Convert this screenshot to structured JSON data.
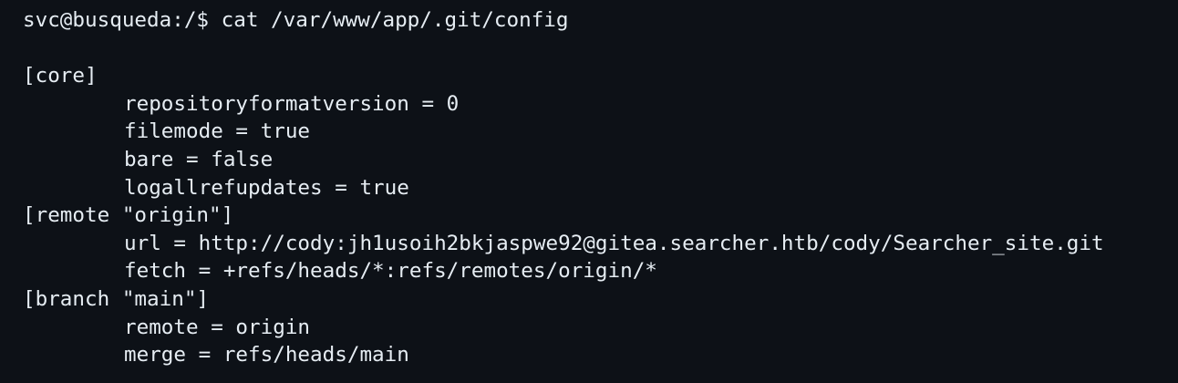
{
  "terminal": {
    "prompt_line": "svc@busqueda:/$ cat /var/www/app/.git/config",
    "output": {
      "core_header": "[core]",
      "core_repositoryformatversion": "repositoryformatversion = 0",
      "core_filemode": "filemode = true",
      "core_bare": "bare = false",
      "core_logallrefupdates": "logallrefupdates = true",
      "remote_header": "[remote \"origin\"]",
      "remote_url": "url = http://cody:jh1usoih2bkjaspwe92@gitea.searcher.htb/cody/Searcher_site.git",
      "remote_fetch": "fetch = +refs/heads/*:refs/remotes/origin/*",
      "branch_header": "[branch \"main\"]",
      "branch_remote": "remote = origin",
      "branch_merge": "merge = refs/heads/main"
    }
  },
  "colors": {
    "background": "#0d1117",
    "foreground": "#e6edf3"
  }
}
